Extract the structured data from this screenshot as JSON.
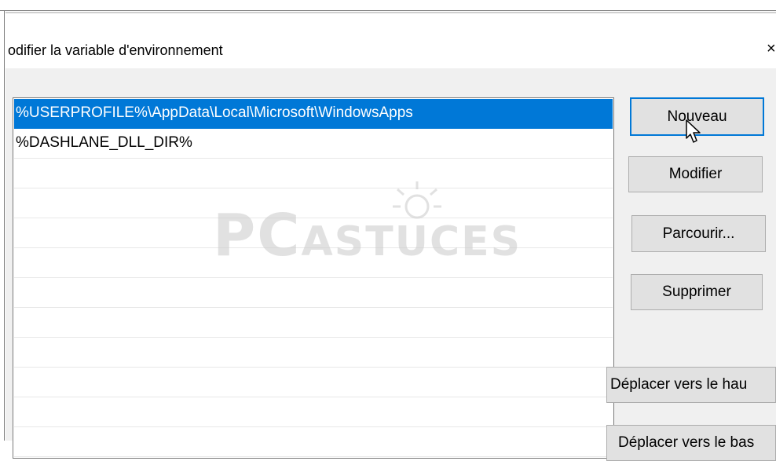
{
  "window": {
    "title": "odifier la variable d'environnement",
    "close_glyph": "×"
  },
  "list": {
    "items": [
      {
        "label": "%USERPROFILE%\\AppData\\Local\\Microsoft\\WindowsApps",
        "selected": true
      },
      {
        "label": "%DASHLANE_DLL_DIR%",
        "selected": false
      }
    ]
  },
  "buttons": {
    "nouveau": "Nouveau",
    "modifier": "Modifier",
    "parcourir": "Parcourir...",
    "supprimer": "Supprimer",
    "deplacer_haut": "Déplacer vers le hau",
    "deplacer_bas": "Déplacer vers le bas"
  },
  "watermark": {
    "logo_part1": "PC",
    "logo_part2": "ASTUCES"
  },
  "colors": {
    "selection": "#0078d7",
    "button_face": "#e1e1e1",
    "dialog_background": "#f0f0f0"
  },
  "icons": [
    "close-icon",
    "mouse-cursor-icon"
  ]
}
